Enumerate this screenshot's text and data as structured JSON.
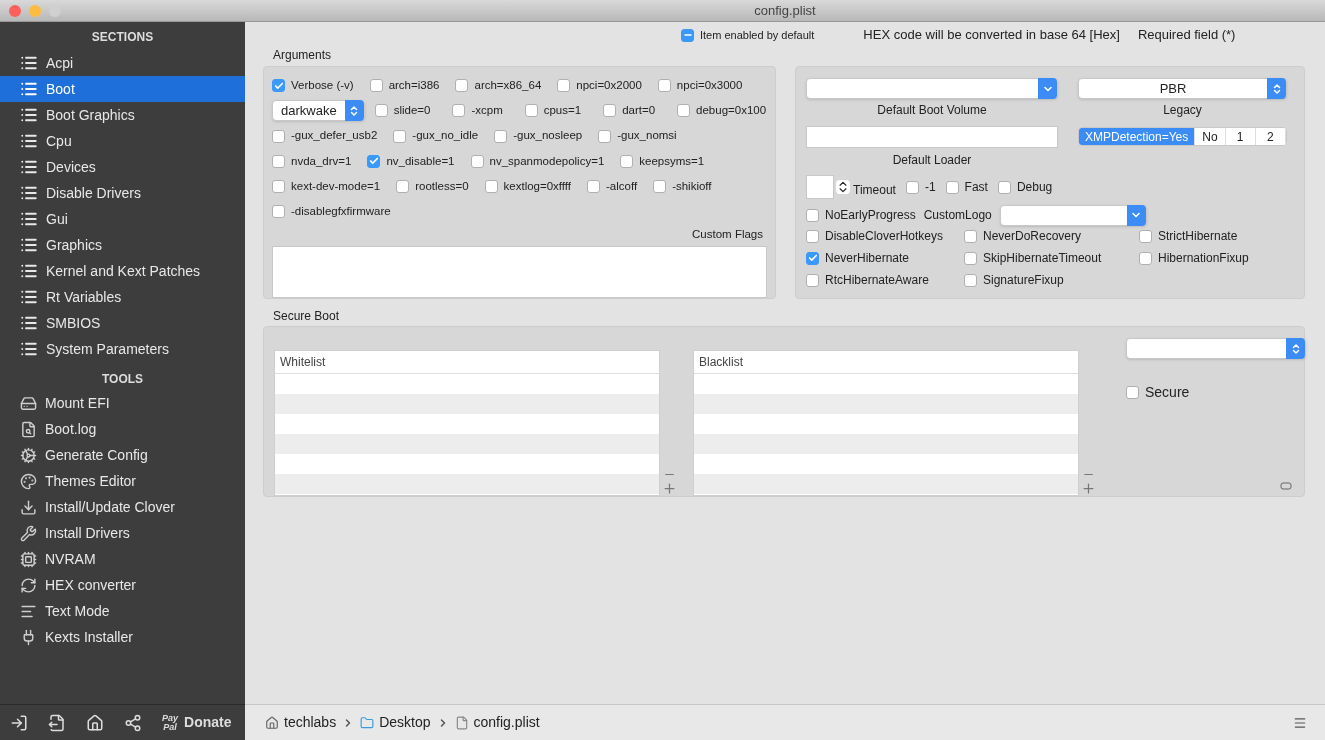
{
  "window": {
    "title": "config.plist"
  },
  "sidebar": {
    "sections_heading": "SECTIONS",
    "sections": [
      {
        "label": "Acpi",
        "selected": false
      },
      {
        "label": "Boot",
        "selected": true
      },
      {
        "label": "Boot Graphics",
        "selected": false
      },
      {
        "label": "Cpu",
        "selected": false
      },
      {
        "label": "Devices",
        "selected": false
      },
      {
        "label": "Disable Drivers",
        "selected": false
      },
      {
        "label": "Gui",
        "selected": false
      },
      {
        "label": "Graphics",
        "selected": false
      },
      {
        "label": "Kernel and Kext Patches",
        "selected": false
      },
      {
        "label": "Rt Variables",
        "selected": false
      },
      {
        "label": "SMBIOS",
        "selected": false
      },
      {
        "label": "System Parameters",
        "selected": false
      }
    ],
    "tools_heading": "TOOLS",
    "tools": [
      {
        "label": "Mount EFI",
        "kind": "disk"
      },
      {
        "label": "Boot.log",
        "kind": "log"
      },
      {
        "label": "Generate Config",
        "kind": "gears"
      },
      {
        "label": "Themes Editor",
        "kind": "palette"
      },
      {
        "label": "Install/Update Clover",
        "kind": "download"
      },
      {
        "label": "Install Drivers",
        "kind": "tools"
      },
      {
        "label": "NVRAM",
        "kind": "chip"
      },
      {
        "label": "HEX converter",
        "kind": "refresh"
      },
      {
        "label": "Text Mode",
        "kind": "text"
      },
      {
        "label": "Kexts Installer",
        "kind": "plug"
      }
    ],
    "footer": {
      "paypal_top": "Pay",
      "paypal_bottom": "Pal",
      "donate": "Donate"
    }
  },
  "header": {
    "item_enabled": {
      "label": "Item enabled by default",
      "mixed": true
    },
    "hex_note": "HEX code will be converted in base 64 [Hex]",
    "required_note": "Required field (*)"
  },
  "arguments": {
    "title": "Arguments",
    "rows": [
      [
        {
          "kind": "checkbox",
          "label": "Verbose (-v)",
          "checked": true
        },
        {
          "kind": "checkbox",
          "label": "arch=i386",
          "checked": false
        },
        {
          "kind": "checkbox",
          "label": "arch=x86_64",
          "checked": false
        },
        {
          "kind": "checkbox",
          "label": "npci=0x2000",
          "checked": false
        },
        {
          "kind": "checkbox",
          "label": "npci=0x3000",
          "checked": false
        }
      ],
      [
        {
          "kind": "popup",
          "label": "darkwake"
        },
        {
          "kind": "checkbox",
          "label": "slide=0",
          "checked": false
        },
        {
          "kind": "checkbox",
          "label": "-xcpm",
          "checked": false
        },
        {
          "kind": "checkbox",
          "label": "cpus=1",
          "checked": false
        },
        {
          "kind": "checkbox",
          "label": "dart=0",
          "checked": false
        },
        {
          "kind": "checkbox",
          "label": "debug=0x100",
          "checked": false
        }
      ],
      [
        {
          "kind": "checkbox",
          "label": "-gux_defer_usb2",
          "checked": false
        },
        {
          "kind": "checkbox",
          "label": "-gux_no_idle",
          "checked": false
        },
        {
          "kind": "checkbox",
          "label": "-gux_nosleep",
          "checked": false
        },
        {
          "kind": "checkbox",
          "label": "-gux_nomsi",
          "checked": false
        }
      ],
      [
        {
          "kind": "checkbox",
          "label": "nvda_drv=1",
          "checked": false
        },
        {
          "kind": "checkbox",
          "label": "nv_disable=1",
          "checked": true
        },
        {
          "kind": "checkbox",
          "label": "nv_spanmodepolicy=1",
          "checked": false
        },
        {
          "kind": "checkbox",
          "label": "keepsyms=1",
          "checked": false
        }
      ],
      [
        {
          "kind": "checkbox",
          "label": "kext-dev-mode=1",
          "checked": false
        },
        {
          "kind": "checkbox",
          "label": "rootless=0",
          "checked": false
        },
        {
          "kind": "checkbox",
          "label": "kextlog=0xffff",
          "checked": false
        },
        {
          "kind": "checkbox",
          "label": "-alcoff",
          "checked": false
        },
        {
          "kind": "checkbox",
          "label": "-shikioff",
          "checked": false
        }
      ],
      [
        {
          "kind": "checkbox",
          "label": "-disablegfxfirmware",
          "checked": false
        }
      ]
    ],
    "custom_flags": {
      "label": "Custom Flags"
    }
  },
  "boot": {
    "default_boot_volume": {
      "label": "Default Boot Volume"
    },
    "legacy": {
      "value": "PBR",
      "label": "Legacy"
    },
    "default_loader": {
      "label": "Default Loader"
    },
    "xmp": [
      {
        "label": "XMPDetection=Yes",
        "selected": true
      },
      {
        "label": "No",
        "selected": false
      },
      {
        "label": "1",
        "selected": false
      },
      {
        "label": "2",
        "selected": false
      }
    ],
    "timeout": {
      "label": "Timeout"
    },
    "timeout_options": [
      {
        "label": "-1",
        "checked": false
      },
      {
        "label": "Fast",
        "checked": false
      },
      {
        "label": "Debug",
        "checked": false
      }
    ],
    "no_early_progress": {
      "label": "NoEarlyProgress",
      "checked": false
    },
    "custom_logo": {
      "label": "CustomLogo"
    },
    "options": [
      [
        {
          "label": "DisableCloverHotkeys",
          "checked": false
        },
        {
          "label": "NeverDoRecovery",
          "checked": false
        },
        {
          "label": "StrictHibernate",
          "checked": false
        }
      ],
      [
        {
          "label": "NeverHibernate",
          "checked": true
        },
        {
          "label": "SkipHibernateTimeout",
          "checked": false
        },
        {
          "label": "HibernationFixup",
          "checked": false
        }
      ],
      [
        {
          "label": "RtcHibernateAware",
          "checked": false
        },
        {
          "label": "SignatureFixup",
          "checked": false
        }
      ]
    ]
  },
  "secure_boot": {
    "title": "Secure Boot",
    "whitelist": {
      "header": "Whitelist"
    },
    "blacklist": {
      "header": "Blacklist"
    },
    "secure": {
      "label": "Secure",
      "checked": false
    }
  },
  "path_bar": [
    {
      "label": "techlabs",
      "kind": "home"
    },
    {
      "label": "Desktop",
      "kind": "folder"
    },
    {
      "label": "config.plist",
      "kind": "file"
    }
  ]
}
